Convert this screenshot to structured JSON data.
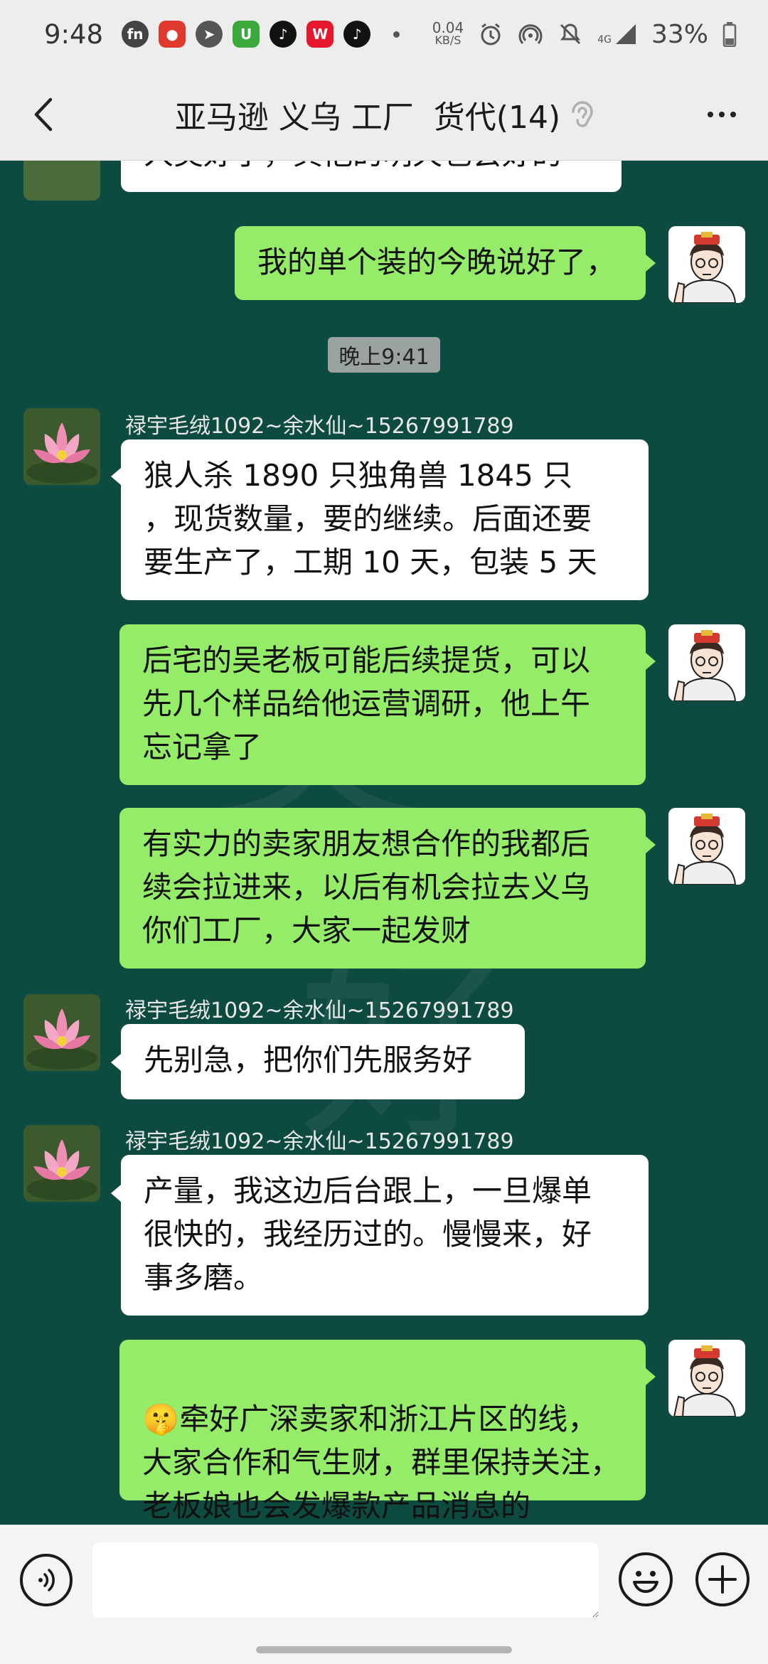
{
  "status_bar": {
    "time": "9:48",
    "net_speed_value": "0.04",
    "net_speed_unit": "KB/S",
    "network": "4G",
    "battery": "33%",
    "app_icons": [
      "fn-icon",
      "kuaishou-icon",
      "sail-icon",
      "utility-icon",
      "tiktok-icon",
      "weibo-icon",
      "tiktok-icon"
    ],
    "status_icons": [
      "alarm-icon",
      "hotspot-icon",
      "mute-icon",
      "signal-icon",
      "battery-icon"
    ]
  },
  "header": {
    "title": "亚马逊 义乌 工厂  货代(14)",
    "back_icon": "chevron-left-icon",
    "mute_icon": "ear-icon",
    "more_icon": "more-dots-icon"
  },
  "chat": {
    "messages": [
      {
        "type": "in",
        "sender": "",
        "text": "人类好了，其他的明天也会好的"
      },
      {
        "type": "out",
        "text": "我的单个装的今晚说好了，"
      },
      {
        "type": "time",
        "text": "晚上9:41"
      },
      {
        "type": "in",
        "sender": "禄宇毛绒1092~余水仙~15267991789",
        "text": "狼人杀 1890 只独角兽 1845 只\n，现货数量，要的继续。后面还要\n要生产了，工期 10 天，包装 5 天"
      },
      {
        "type": "out",
        "text": "后宅的吴老板可能后续提货，可以\n先几个样品给他运营调研，他上午\n忘记拿了"
      },
      {
        "type": "out",
        "text": "有实力的卖家朋友想合作的我都后\n续会拉进来，以后有机会拉去义乌\n你们工厂，大家一起发财"
      },
      {
        "type": "in",
        "sender": "禄宇毛绒1092~余水仙~15267991789",
        "text": "先别急，把你们先服务好"
      },
      {
        "type": "in",
        "sender": "禄宇毛绒1092~余水仙~15267991789",
        "text": "产量，我这边后台跟上，一旦爆单\n很快的，我经历过的。慢慢来，好\n事多磨。"
      },
      {
        "type": "out",
        "emoji": "🤫",
        "text": "牵好广深卖家和浙江片区的线，\n大家合作和气生财，群里保持关注，\n老板娘也会发爆款产品消息的"
      }
    ]
  },
  "input_bar": {
    "voice_icon": "voice-icon",
    "emoji_icon": "emoji-icon",
    "plus_icon": "plus-icon",
    "draft": ""
  },
  "colors": {
    "chat_bg": "#0d4a3f",
    "bubble_out": "#95ec69",
    "bubble_in": "#ffffff",
    "bar_bg": "#ededed"
  }
}
